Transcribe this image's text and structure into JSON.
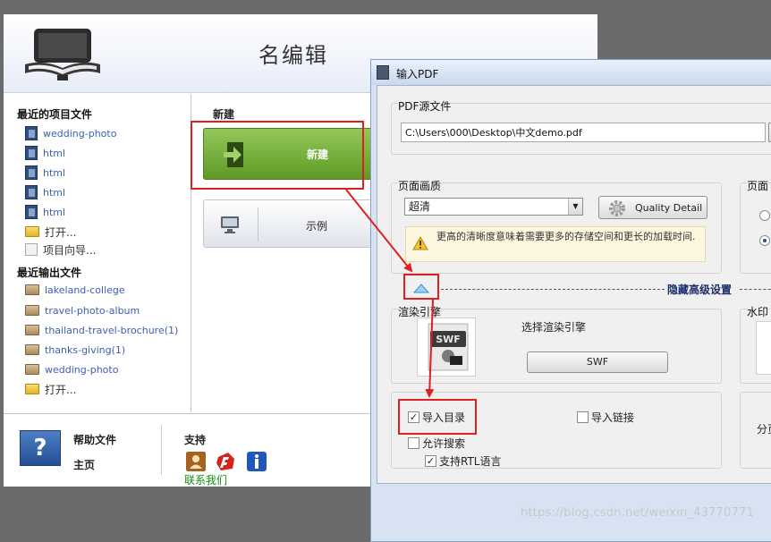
{
  "main_window": {
    "title": "名编辑",
    "recent_projects": {
      "title": "最近的项目文件",
      "items": [
        "wedding-photo",
        "html",
        "html",
        "html",
        "html"
      ],
      "open_label": "打开...",
      "wizard_label": "项目向导..."
    },
    "recent_outputs": {
      "title": "最近输出文件",
      "items": [
        "lakeland-college",
        "travel-photo-album",
        "thailand-travel-brochure(1)",
        "thanks-giving(1)",
        "wedding-photo"
      ],
      "open_label": "打开..."
    },
    "new_section": {
      "title": "新建",
      "new_button": "新建",
      "example_button": "示例"
    },
    "footer": {
      "help_title": "帮助文件",
      "help_icon_glyph": "?",
      "home_link": "主页",
      "support_title": "支持",
      "contact_link": "联系我们"
    }
  },
  "dialog": {
    "title": "输入PDF",
    "pdf_source": {
      "label": "PDF源文件",
      "path": "C:\\Users\\000\\Desktop\\中文demo.pdf"
    },
    "page_quality": {
      "label": "页面画质",
      "selected": "超清",
      "quality_button": "Quality Detail",
      "warning": "更高的清晰度意味着需要更多的存储空间和更长的加载时间."
    },
    "page_right_label": "页面",
    "advanced_label": "隐藏高级设置",
    "render_engine": {
      "label": "渲染引擎",
      "select_label": "选择渲染引擎",
      "button": "SWF",
      "preview_text": "SWF"
    },
    "watermark_label": "水印",
    "options": {
      "import_toc": "导入目录",
      "import_links": "导入链接",
      "allow_search": "允许搜索",
      "rtl": "支持RTL语言",
      "import_toc_checked": true,
      "import_links_checked": false,
      "allow_search_checked": false,
      "rtl_checked": true
    },
    "right_partial_label": "分页"
  },
  "watermark_text": "https://blog.csdn.net/weixin_43770771",
  "colors": {
    "annotation_red": "#e02020",
    "new_button_green": "#6aa82e",
    "link_blue": "#3b5fb5",
    "advanced_label": "#1b2c6b"
  }
}
